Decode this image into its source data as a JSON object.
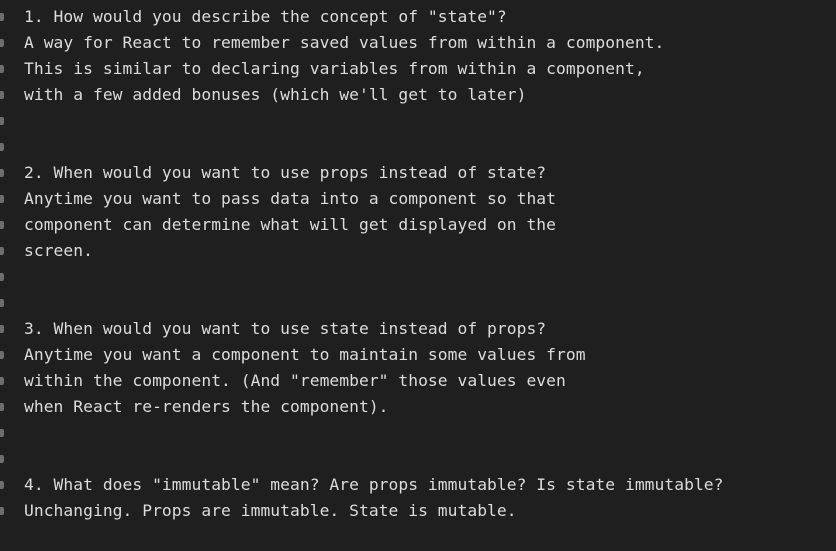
{
  "document": {
    "lines": [
      "1. How would you describe the concept of \"state\"?",
      "A way for React to remember saved values from within a component.",
      "This is similar to declaring variables from within a component,",
      "with a few added bonuses (which we'll get to later)",
      "",
      "",
      "2. When would you want to use props instead of state?",
      "Anytime you want to pass data into a component so that",
      "component can determine what will get displayed on the",
      "screen.",
      "",
      "",
      "3. When would you want to use state instead of props?",
      "Anytime you want a component to maintain some values from",
      "within the component. (And \"remember\" those values even",
      "when React re-renders the component).",
      "",
      "",
      "4. What does \"immutable\" mean? Are props immutable? Is state immutable?",
      "Unchanging. Props are immutable. State is mutable."
    ]
  },
  "colors": {
    "background": "#1f1f1f",
    "text": "#dcdcdc",
    "gutter_marker": "#6d6d6d"
  }
}
